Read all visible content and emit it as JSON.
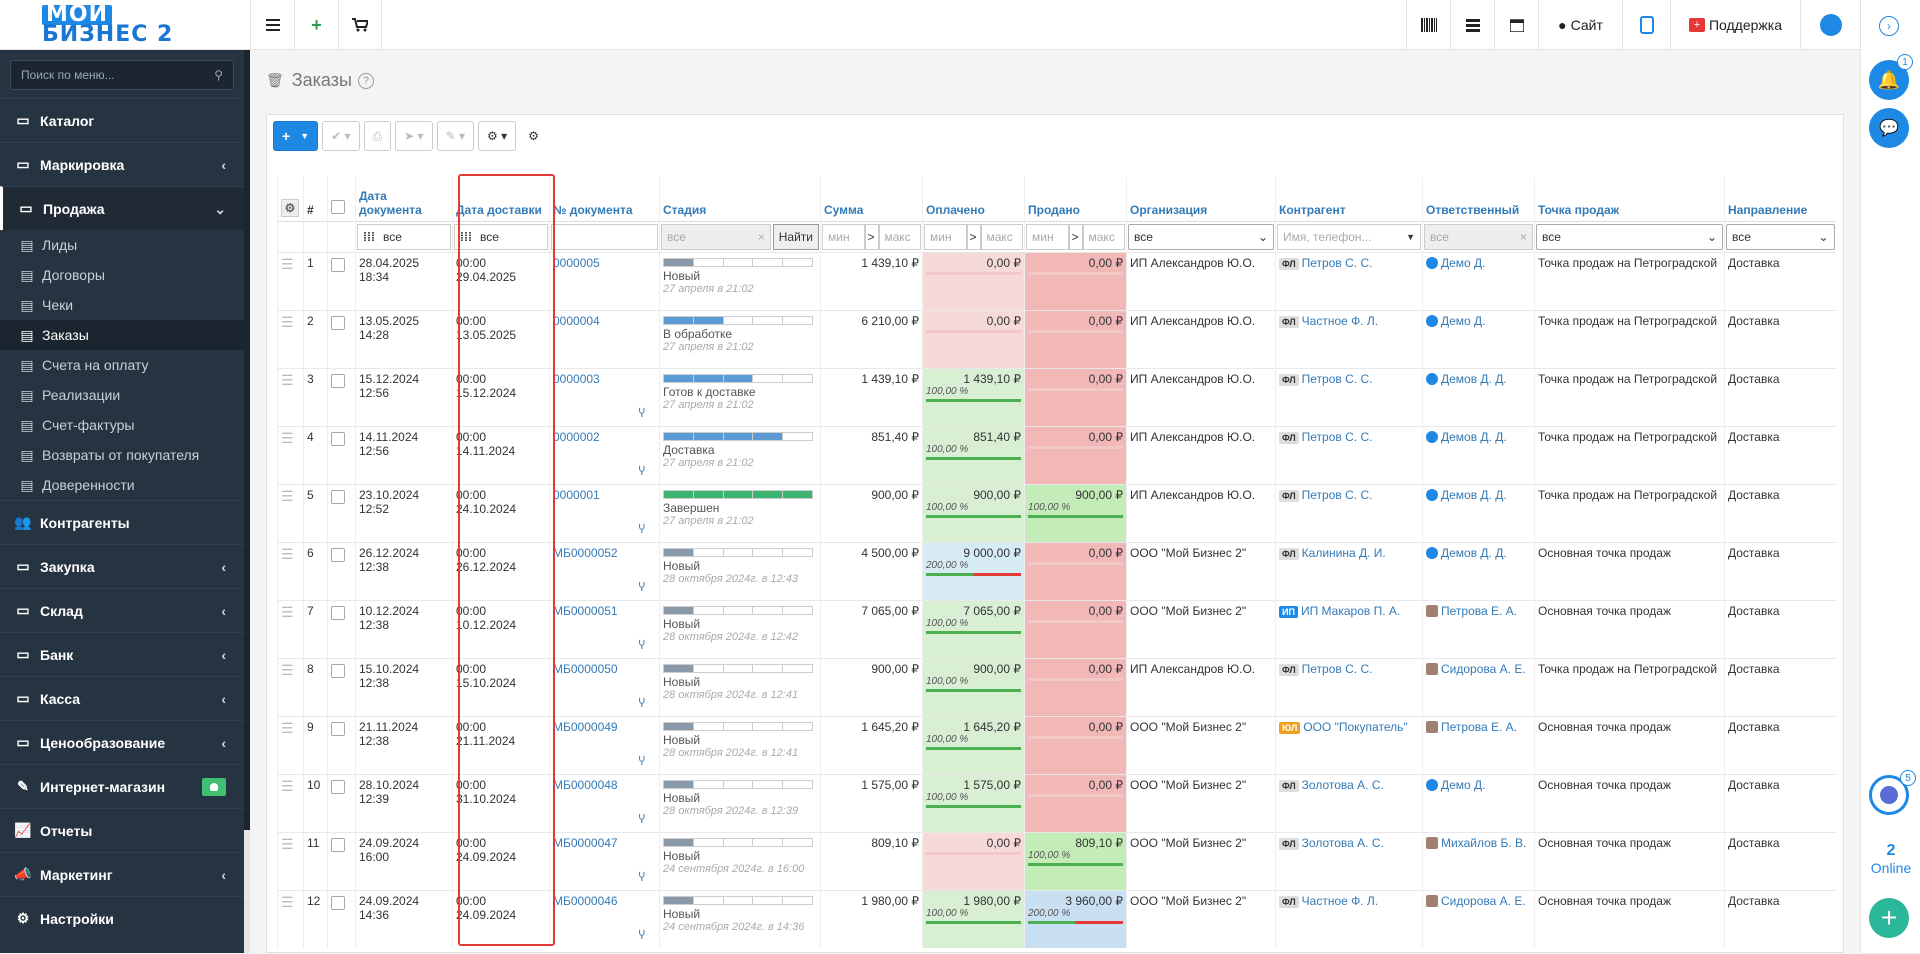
{
  "header": {
    "logo_line1": "МОЙ",
    "logo_line2": "БИЗНЕС 2",
    "site_label": "Сайт",
    "support_label": "Поддержка"
  },
  "sidebar": {
    "search_placeholder": "Поиск по меню...",
    "items": [
      {
        "label": "Каталог",
        "icon": "folder-icon",
        "chevron": ""
      },
      {
        "label": "Маркировка",
        "icon": "folder-icon",
        "chevron": "‹"
      },
      {
        "label": "Продажа",
        "icon": "folder-icon",
        "chevron": "⌄"
      },
      {
        "label": "Контрагенты",
        "icon": "users-icon",
        "chevron": ""
      },
      {
        "label": "Закупка",
        "icon": "folder-icon",
        "chevron": "‹"
      },
      {
        "label": "Склад",
        "icon": "folder-icon",
        "chevron": "‹"
      },
      {
        "label": "Банк",
        "icon": "folder-icon",
        "chevron": "‹"
      },
      {
        "label": "Касса",
        "icon": "folder-icon",
        "chevron": "‹"
      },
      {
        "label": "Ценообразование",
        "icon": "folder-icon",
        "chevron": "‹"
      },
      {
        "label": "Интернет-магазин",
        "icon": "magic-wand-icon",
        "chevron": ""
      },
      {
        "label": "Отчеты",
        "icon": "chart-icon",
        "chevron": ""
      },
      {
        "label": "Маркетинг",
        "icon": "bullhorn-icon",
        "chevron": "‹"
      },
      {
        "label": "Настройки",
        "icon": "gear-icon",
        "chevron": ""
      }
    ],
    "sub_items": [
      {
        "label": "Лиды"
      },
      {
        "label": "Договоры"
      },
      {
        "label": "Чеки"
      },
      {
        "label": "Заказы"
      },
      {
        "label": "Счета на оплату"
      },
      {
        "label": "Реализации"
      },
      {
        "label": "Счет-фактуры"
      },
      {
        "label": "Возвраты от покупателя"
      },
      {
        "label": "Доверенности"
      }
    ]
  },
  "page": {
    "title": "Заказы",
    "help": "?"
  },
  "table": {
    "headers": {
      "num": "#",
      "doc_date": "Дата документа",
      "delivery_date": "Дата доставки",
      "doc_number": "№ документа",
      "stage": "Стадия",
      "sum": "Сумма",
      "paid": "Оплачено",
      "sold": "Продано",
      "org": "Организация",
      "contractor": "Контрагент",
      "responsible": "Ответственный",
      "point": "Точка продаж",
      "direction": "Направление"
    },
    "filters": {
      "doc_date": "все",
      "delivery_date": "все",
      "stage": "все",
      "find": "Найти",
      "min": "мин",
      "max": "макс",
      "org": "все",
      "contractor": "Имя, телефон...",
      "responsible": "все",
      "point": "все",
      "direction": "все"
    },
    "rows": [
      {
        "n": "1",
        "doc_date": "28.04.2025",
        "doc_time": "18:34",
        "del_time": "00:00",
        "del_date": "29.04.2025",
        "number": "0000005",
        "stage": "Новый",
        "stage_date": "27 апреля в 21:02",
        "stage_fill": 1,
        "stage_color": "#8a9aa8",
        "sum": "1 439,10 ₽",
        "paid": "0,00 ₽",
        "paid_pct": "",
        "paid_bg": "#f6dada",
        "sold": "0,00 ₽",
        "sold_pct": "",
        "sold_bg": "#f2b8b8",
        "org": "ИП Александров Ю.О.",
        "ctype": "ФЛ",
        "contractor": "Петров С. С.",
        "resp": "Демо Д.",
        "point": "Точка продаж на Петроградской",
        "dir": "Доставка"
      },
      {
        "n": "2",
        "doc_date": "13.05.2025",
        "doc_time": "14:28",
        "del_time": "00:00",
        "del_date": "13.05.2025",
        "number": "0000004",
        "stage": "В обработке",
        "stage_date": "27 апреля в 21:02",
        "stage_fill": 2,
        "stage_color": "#5b9bd5",
        "sum": "6 210,00 ₽",
        "paid": "0,00 ₽",
        "paid_pct": "",
        "paid_bg": "#f6dada",
        "sold": "0,00 ₽",
        "sold_pct": "",
        "sold_bg": "#f2b8b8",
        "org": "ИП Александров Ю.О.",
        "ctype": "ФЛ",
        "contractor": "Частное Ф. Л.",
        "resp": "Демо Д.",
        "point": "Точка продаж на Петроградской",
        "dir": "Доставка"
      },
      {
        "n": "3",
        "doc_date": "15.12.2024",
        "doc_time": "12:56",
        "del_time": "00:00",
        "del_date": "15.12.2024",
        "number": "0000003",
        "stage": "Готов к доставке",
        "stage_date": "27 апреля в 21:02",
        "stage_fill": 3,
        "stage_color": "#5b9bd5",
        "sum": "1 439,10 ₽",
        "paid": "1 439,10 ₽",
        "paid_pct": "100,00 %",
        "paid_bg": "#d8efd4",
        "sold": "0,00 ₽",
        "sold_pct": "",
        "sold_bg": "#f2b8b8",
        "org": "ИП Александров Ю.О.",
        "ctype": "ФЛ",
        "contractor": "Петров С. С.",
        "resp": "Демов Д. Д.",
        "point": "Точка продаж на Петроградской",
        "dir": "Доставка"
      },
      {
        "n": "4",
        "doc_date": "14.11.2024",
        "doc_time": "12:56",
        "del_time": "00:00",
        "del_date": "14.11.2024",
        "number": "0000002",
        "stage": "Доставка",
        "stage_date": "27 апреля в 21:02",
        "stage_fill": 4,
        "stage_color": "#5b9bd5",
        "sum": "851,40 ₽",
        "paid": "851,40 ₽",
        "paid_pct": "100,00 %",
        "paid_bg": "#d8efd4",
        "sold": "0,00 ₽",
        "sold_pct": "",
        "sold_bg": "#f2b8b8",
        "org": "ИП Александров Ю.О.",
        "ctype": "ФЛ",
        "contractor": "Петров С. С.",
        "resp": "Демов Д. Д.",
        "point": "Точка продаж на Петроградской",
        "dir": "Доставка"
      },
      {
        "n": "5",
        "doc_date": "23.10.2024",
        "doc_time": "12:52",
        "del_time": "00:00",
        "del_date": "24.10.2024",
        "number": "0000001",
        "stage": "Завершен",
        "stage_date": "27 апреля в 21:02",
        "stage_fill": 5,
        "stage_color": "#3cb371",
        "sum": "900,00 ₽",
        "paid": "900,00 ₽",
        "paid_pct": "100,00 %",
        "paid_bg": "#d8efd4",
        "sold": "900,00 ₽",
        "sold_pct": "100,00 %",
        "sold_bg": "#c4ecb8",
        "org": "ИП Александров Ю.О.",
        "ctype": "ФЛ",
        "contractor": "Петров С. С.",
        "resp": "Демов Д. Д.",
        "point": "Точка продаж на Петроградской",
        "dir": "Доставка"
      },
      {
        "n": "6",
        "doc_date": "26.12.2024",
        "doc_time": "12:38",
        "del_time": "00:00",
        "del_date": "26.12.2024",
        "number": "МБ0000052",
        "stage": "Новый",
        "stage_date": "28 октября 2024г. в 12:43",
        "stage_fill": 1,
        "stage_color": "#8a9aa8",
        "sum": "4 500,00 ₽",
        "paid": "9 000,00 ₽",
        "paid_pct": "200,00 %",
        "paid_bg": "#d7ebf5",
        "sold": "0,00 ₽",
        "sold_pct": "",
        "sold_bg": "#f2b8b8",
        "org": "ООО \"Мой Бизнес 2\"",
        "ctype": "ФЛ",
        "contractor": "Калинина Д. И.",
        "resp": "Демов Д. Д.",
        "point": "Основная точка продаж",
        "dir": "Доставка"
      },
      {
        "n": "7",
        "doc_date": "10.12.2024",
        "doc_time": "12:38",
        "del_time": "00:00",
        "del_date": "10.12.2024",
        "number": "МБ0000051",
        "stage": "Новый",
        "stage_date": "28 октября 2024г. в 12:42",
        "stage_fill": 1,
        "stage_color": "#8a9aa8",
        "sum": "7 065,00 ₽",
        "paid": "7 065,00 ₽",
        "paid_pct": "100,00 %",
        "paid_bg": "#d8efd4",
        "sold": "0,00 ₽",
        "sold_pct": "",
        "sold_bg": "#f2b8b8",
        "org": "ООО \"Мой Бизнес 2\"",
        "ctype": "ИП",
        "contractor": "ИП Макаров П. А.",
        "resp": "Петрова Е. А.",
        "point": "Основная точка продаж",
        "dir": "Доставка"
      },
      {
        "n": "8",
        "doc_date": "15.10.2024",
        "doc_time": "12:38",
        "del_time": "00:00",
        "del_date": "15.10.2024",
        "number": "МБ0000050",
        "stage": "Новый",
        "stage_date": "28 октября 2024г. в 12:41",
        "stage_fill": 1,
        "stage_color": "#8a9aa8",
        "sum": "900,00 ₽",
        "paid": "900,00 ₽",
        "paid_pct": "100,00 %",
        "paid_bg": "#d8efd4",
        "sold": "0,00 ₽",
        "sold_pct": "",
        "sold_bg": "#f2b8b8",
        "org": "ИП Александров Ю.О.",
        "ctype": "ФЛ",
        "contractor": "Петров С. С.",
        "resp": "Сидорова А. Е.",
        "point": "Точка продаж на Петроградской",
        "dir": "Доставка"
      },
      {
        "n": "9",
        "doc_date": "21.11.2024",
        "doc_time": "12:38",
        "del_time": "00:00",
        "del_date": "21.11.2024",
        "number": "МБ0000049",
        "stage": "Новый",
        "stage_date": "28 октября 2024г. в 12:41",
        "stage_fill": 1,
        "stage_color": "#8a9aa8",
        "sum": "1 645,20 ₽",
        "paid": "1 645,20 ₽",
        "paid_pct": "100,00 %",
        "paid_bg": "#d8efd4",
        "sold": "0,00 ₽",
        "sold_pct": "",
        "sold_bg": "#f2b8b8",
        "org": "ООО \"Мой Бизнес 2\"",
        "ctype": "ЮЛ",
        "contractor": "ООО \"Покупатель\"",
        "resp": "Петрова Е. А.",
        "point": "Основная точка продаж",
        "dir": "Доставка"
      },
      {
        "n": "10",
        "doc_date": "28.10.2024",
        "doc_time": "12:39",
        "del_time": "00:00",
        "del_date": "31.10.2024",
        "number": "МБ0000048",
        "stage": "Новый",
        "stage_date": "28 октября 2024г. в 12:39",
        "stage_fill": 1,
        "stage_color": "#8a9aa8",
        "sum": "1 575,00 ₽",
        "paid": "1 575,00 ₽",
        "paid_pct": "100,00 %",
        "paid_bg": "#d8efd4",
        "sold": "0,00 ₽",
        "sold_pct": "",
        "sold_bg": "#f2b8b8",
        "org": "ООО \"Мой Бизнес 2\"",
        "ctype": "ФЛ",
        "contractor": "Золотова А. С.",
        "resp": "Демо Д.",
        "point": "Основная точка продаж",
        "dir": "Доставка"
      },
      {
        "n": "11",
        "doc_date": "24.09.2024",
        "doc_time": "16:00",
        "del_time": "00:00",
        "del_date": "24.09.2024",
        "number": "МБ0000047",
        "stage": "Новый",
        "stage_date": "24 сентября 2024г. в 16:00",
        "stage_fill": 1,
        "stage_color": "#8a9aa8",
        "sum": "809,10 ₽",
        "paid": "0,00 ₽",
        "paid_pct": "",
        "paid_bg": "#f6dada",
        "sold": "809,10 ₽",
        "sold_pct": "100,00 %",
        "sold_bg": "#c4ecb8",
        "org": "ООО \"Мой Бизнес 2\"",
        "ctype": "ФЛ",
        "contractor": "Золотова А. С.",
        "resp": "Михайлов Б. В.",
        "point": "Основная точка продаж",
        "dir": "Доставка"
      },
      {
        "n": "12",
        "doc_date": "24.09.2024",
        "doc_time": "14:36",
        "del_time": "00:00",
        "del_date": "24.09.2024",
        "number": "МБ0000046",
        "stage": "Новый",
        "stage_date": "24 сентября 2024г. в 14:36",
        "stage_fill": 1,
        "stage_color": "#8a9aa8",
        "sum": "1 980,00 ₽",
        "paid": "1 980,00 ₽",
        "paid_pct": "100,00 %",
        "paid_bg": "#d8efd4",
        "sold": "3 960,00 ₽",
        "sold_pct": "200,00 %",
        "sold_bg": "#c9dff2",
        "org": "ООО \"Мой Бизнес 2\"",
        "ctype": "ФЛ",
        "contractor": "Частное Ф. Л.",
        "resp": "Сидорова А. Е.",
        "point": "Основная точка продаж",
        "dir": "Доставка"
      }
    ]
  },
  "rightbar": {
    "notif_count": "1",
    "chat_count": "5",
    "online_count": "2",
    "online_label": "Online"
  }
}
